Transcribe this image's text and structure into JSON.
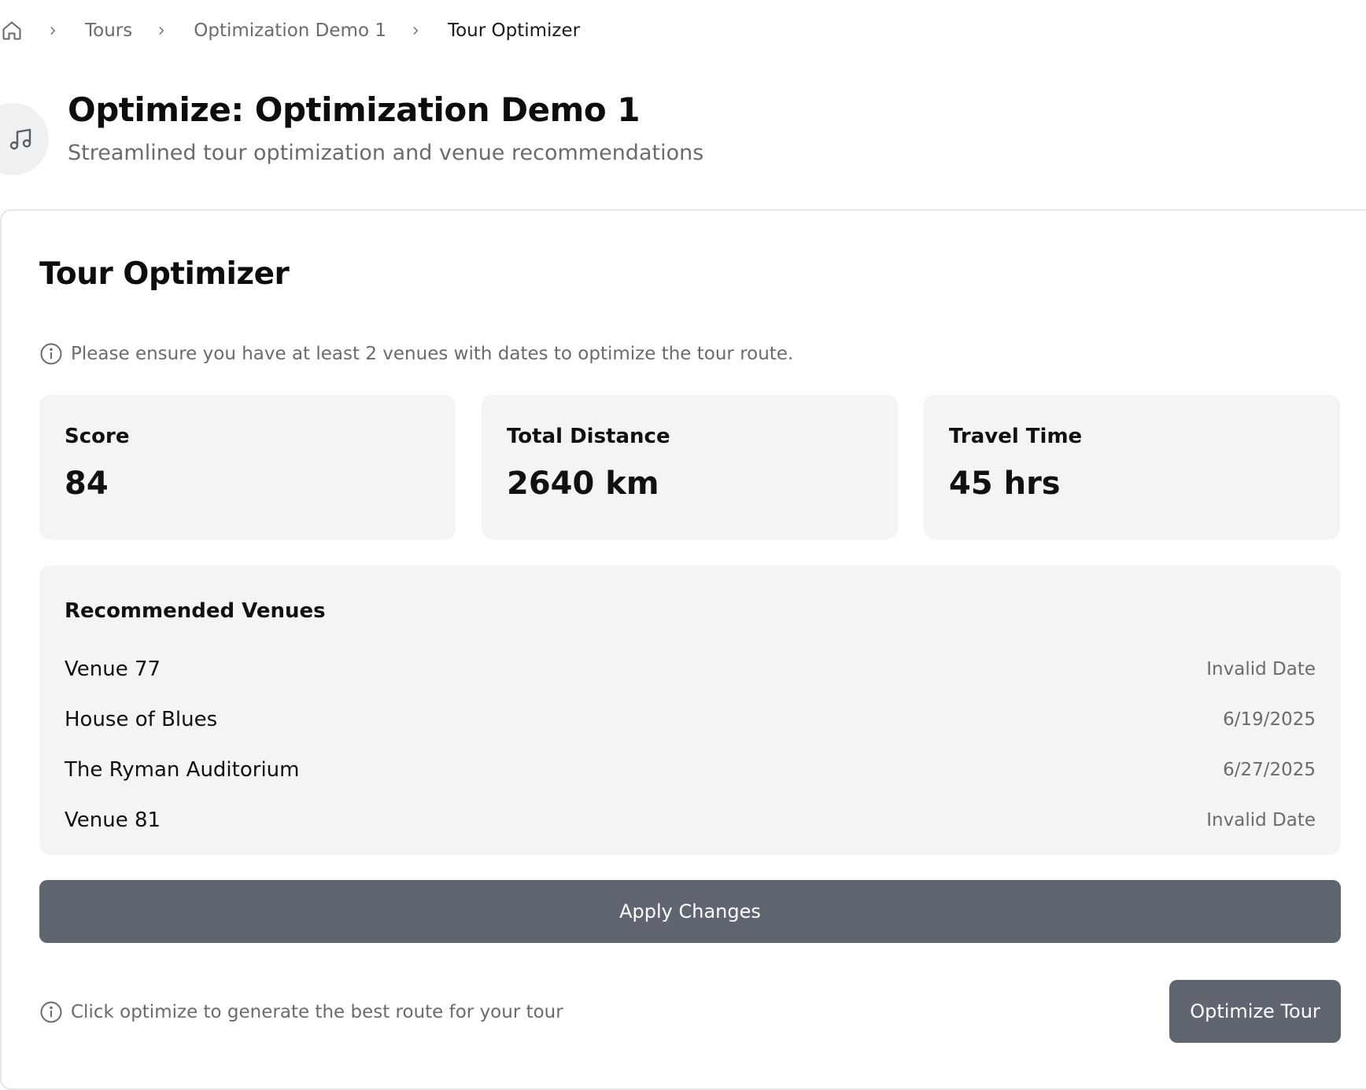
{
  "breadcrumb": {
    "home_icon": "home-icon",
    "items": [
      "Tours",
      "Optimization Demo 1"
    ],
    "current": "Tour Optimizer"
  },
  "header": {
    "icon": "music-note-icon",
    "title": "Optimize: Optimization Demo 1",
    "subtitle": "Streamlined tour optimization and venue recommendations"
  },
  "optimizer": {
    "title": "Tour Optimizer",
    "notice": "Please ensure you have at least 2 venues with dates to optimize the tour route.",
    "stats": [
      {
        "label": "Score",
        "value": "84"
      },
      {
        "label": "Total Distance",
        "value": "2640 km"
      },
      {
        "label": "Travel Time",
        "value": "45 hrs"
      }
    ],
    "recommended": {
      "title": "Recommended Venues",
      "venues": [
        {
          "name": "Venue 77",
          "date": "Invalid Date"
        },
        {
          "name": "House of Blues",
          "date": "6/19/2025"
        },
        {
          "name": "The Ryman Auditorium",
          "date": "6/27/2025"
        },
        {
          "name": "Venue 81",
          "date": "Invalid Date"
        }
      ]
    },
    "apply_label": "Apply Changes",
    "footer_hint": "Click optimize to generate the best route for your tour",
    "optimize_label": "Optimize Tour"
  },
  "colors": {
    "button_bg": "#5f6670",
    "panel_bg": "#f4f4f3",
    "muted_text": "#6b6b6b",
    "icon_circle": "#eef0f2"
  }
}
